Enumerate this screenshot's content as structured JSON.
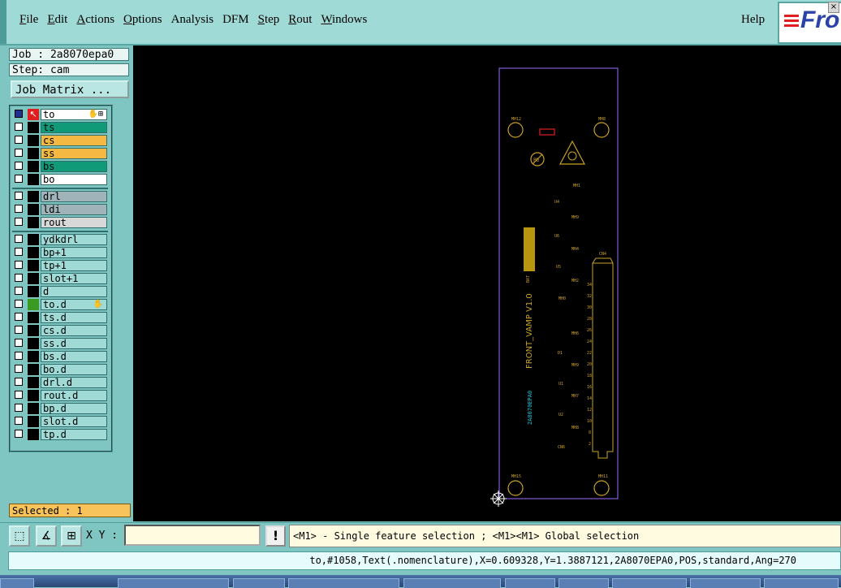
{
  "menu": {
    "items": [
      {
        "label": "File",
        "u": "F",
        "rest": "ile"
      },
      {
        "label": "Edit",
        "u": "E",
        "rest": "dit"
      },
      {
        "label": "Actions",
        "u": "A",
        "rest": "ctions"
      },
      {
        "label": "Options",
        "u": "O",
        "rest": "ptions"
      },
      {
        "label": "Analysis",
        "u": "",
        "rest": "Analysis"
      },
      {
        "label": "DFM",
        "u": "",
        "rest": "DFM"
      },
      {
        "label": "Step",
        "u": "S",
        "rest": "tep"
      },
      {
        "label": "Rout",
        "u": "R",
        "rest": "out"
      },
      {
        "label": "Windows",
        "u": "W",
        "rest": "indows"
      }
    ],
    "help": "Help",
    "logo_text": "Fro"
  },
  "job": {
    "job_line": "Job : 2a8070epa0",
    "step_line": "Step: cam",
    "matrix_button": "Job Matrix ..."
  },
  "layers": {
    "group1": [
      {
        "name": "to",
        "bg": "#ffffff",
        "swatch": "#000000",
        "active": true
      },
      {
        "name": "ts",
        "bg": "#119a78",
        "swatch": "#000000"
      },
      {
        "name": "cs",
        "bg": "#f5b842",
        "swatch": "#000000"
      },
      {
        "name": "ss",
        "bg": "#f5b842",
        "swatch": "#000000"
      },
      {
        "name": "bs",
        "bg": "#119a78",
        "swatch": "#000000"
      },
      {
        "name": "bo",
        "bg": "#ffffff",
        "swatch": "#000000"
      }
    ],
    "group2": [
      {
        "name": "drl",
        "bg": "#9fb3b8",
        "swatch": "#000000"
      },
      {
        "name": "ldi",
        "bg": "#9fb3b8",
        "swatch": "#000000"
      },
      {
        "name": "rout",
        "bg": "#d8d8d8",
        "swatch": "#000000"
      }
    ],
    "group3": [
      {
        "name": "ydkdrl",
        "bg": "#9fdad6",
        "swatch": "#000000"
      },
      {
        "name": "bp+1",
        "bg": "#9fdad6",
        "swatch": "#000000"
      },
      {
        "name": "tp+1",
        "bg": "#9fdad6",
        "swatch": "#000000"
      },
      {
        "name": "slot+1",
        "bg": "#9fdad6",
        "swatch": "#000000"
      },
      {
        "name": "d",
        "bg": "#9fdad6",
        "swatch": "#000000"
      },
      {
        "name": "to.d",
        "bg": "#9fdad6",
        "swatch": "#3a9a22",
        "hand": true
      },
      {
        "name": "ts.d",
        "bg": "#9fdad6",
        "swatch": "#000000"
      },
      {
        "name": "cs.d",
        "bg": "#9fdad6",
        "swatch": "#000000"
      },
      {
        "name": "ss.d",
        "bg": "#9fdad6",
        "swatch": "#000000"
      },
      {
        "name": "bs.d",
        "bg": "#9fdad6",
        "swatch": "#000000"
      },
      {
        "name": "bo.d",
        "bg": "#9fdad6",
        "swatch": "#000000"
      },
      {
        "name": "drl.d",
        "bg": "#9fdad6",
        "swatch": "#000000"
      },
      {
        "name": "rout.d",
        "bg": "#9fdad6",
        "swatch": "#000000"
      },
      {
        "name": "bp.d",
        "bg": "#9fdad6",
        "swatch": "#000000"
      },
      {
        "name": "slot.d",
        "bg": "#9fdad6",
        "swatch": "#000000"
      },
      {
        "name": "tp.d",
        "bg": "#9fdad6",
        "swatch": "#000000"
      }
    ]
  },
  "selected": "Selected : 1",
  "board": {
    "vertical_text": "FRONT_VAMP V1.0",
    "code_text": "2A8070EPA0",
    "connector_label": "CN4",
    "colors": {
      "outline": "#9b6cff",
      "silk": "#c9a227",
      "cyan": "#19c3d6",
      "red": "#e02020"
    }
  },
  "bottom": {
    "xy_label": "X Y :",
    "xy_value": "",
    "excl": "!",
    "message": "<M1> - Single feature selection ; <M1><M1> Global selection"
  },
  "status": "to,#1058,Text(.nomenclature),X=0.609328,Y=1.3887121,2A8070EPA0,POS,standard,Ang=270"
}
